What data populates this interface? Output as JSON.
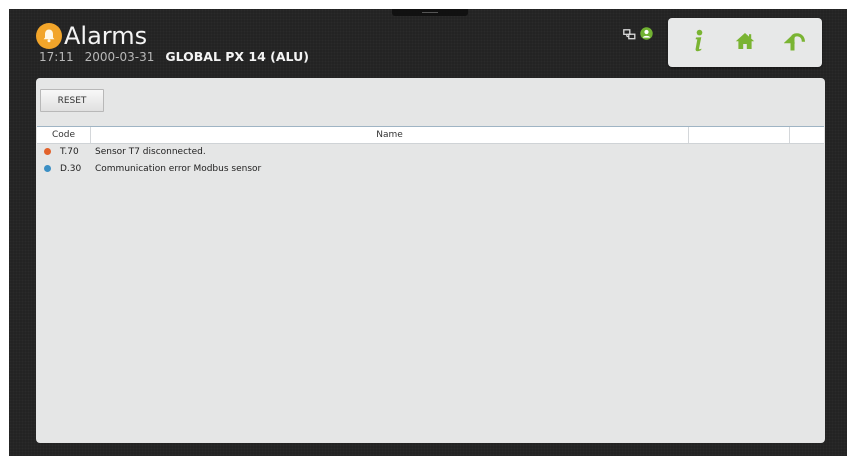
{
  "header": {
    "title": "Alarms",
    "time": "17:11",
    "date": "2000-03-31",
    "device": "GLOBAL PX 14 (ALU)",
    "title_icon": "bell-icon",
    "status_icons": [
      "network-icon",
      "user-icon"
    ]
  },
  "nav": {
    "buttons": [
      {
        "icon": "info-icon"
      },
      {
        "icon": "home-icon"
      },
      {
        "icon": "back-icon"
      }
    ]
  },
  "toolbar": {
    "reset_label": "RESET"
  },
  "table": {
    "columns": [
      "Code",
      "Name",
      "",
      ""
    ],
    "rows": [
      {
        "code": "T.70",
        "name": "Sensor T7 disconnected.",
        "status_color": "#e2622b"
      },
      {
        "code": "D.30",
        "name": "Communication error Modbus sensor",
        "status_color": "#3b8fc4"
      }
    ]
  },
  "colors": {
    "accent_orange": "#f2a52a",
    "nav_green": "#7ab432",
    "panel_bg": "#e5e6e6",
    "screen_bg": "#232323"
  }
}
